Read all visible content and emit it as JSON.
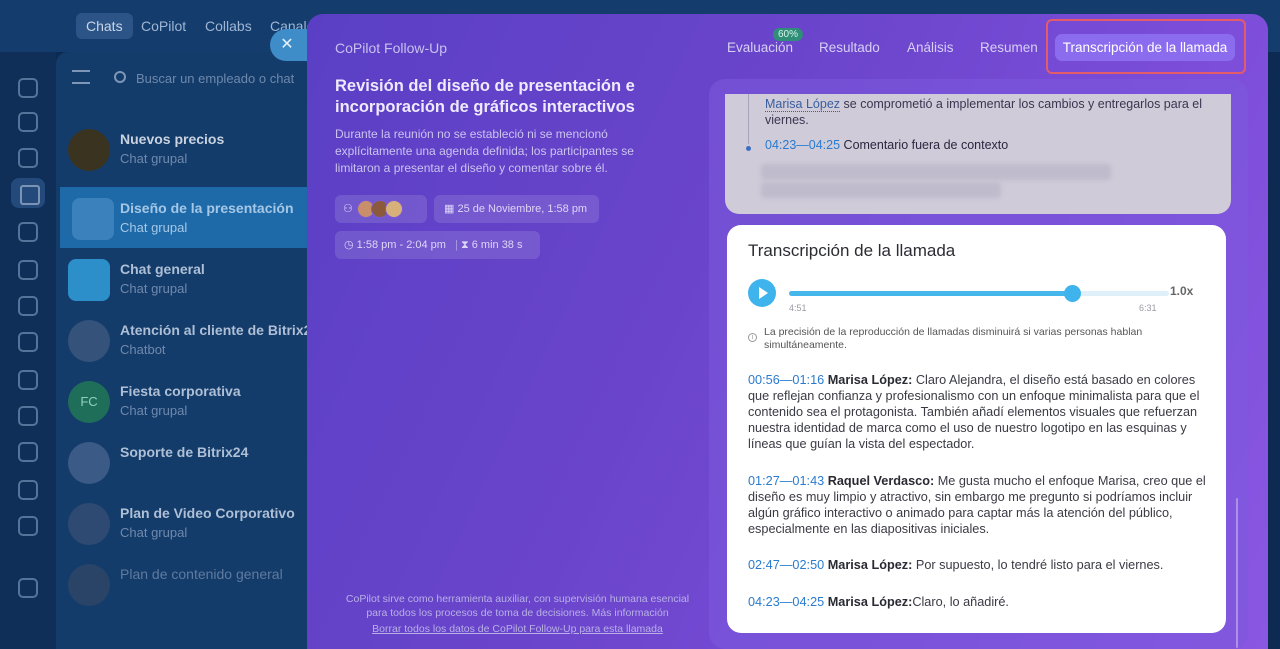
{
  "topnav": {
    "tabs": [
      "Chats",
      "CoPilot",
      "Collabs",
      "Canale"
    ]
  },
  "chatlist": {
    "search_placeholder": "Buscar un empleado o chat",
    "items": [
      {
        "name": "Nuevos precios",
        "sub": "Chat grupal"
      },
      {
        "name": "Diseño de la presentación",
        "sub": "Chat grupal"
      },
      {
        "name": "Chat general",
        "sub": "Chat grupal"
      },
      {
        "name": "Atención al cliente de Bitrix2",
        "sub": "Chatbot"
      },
      {
        "name": "Fiesta corporativa",
        "sub": "Chat grupal",
        "avatar_text": "FC"
      },
      {
        "name": "Soporte de Bitrix24",
        "sub": ""
      },
      {
        "name": "Plan de Video Corporativo",
        "sub": "Chat grupal"
      },
      {
        "name": "Plan de contenido general",
        "sub": ""
      }
    ]
  },
  "panel": {
    "title": "CoPilot Follow-Up",
    "tabs": {
      "evaluacion": "Evaluación",
      "evaluacion_badge": "60%",
      "resultado": "Resultado",
      "analisis": "Análisis",
      "resumen": "Resumen",
      "transcripcion": "Transcripción de la llamada"
    },
    "event_title": "Revisión del diseño de presentación e incorporación de gráficos interactivos",
    "event_desc": "Durante la reunión no se estableció ni se mencionó explícitamente una agenda definida; los participantes se limitaron a presentar el diseño y comentar sobre él.",
    "date": "25 de Noviembre, 1:58 pm",
    "time_range": "1:58 pm - 2:04 pm",
    "duration": "6 min 38 s",
    "footer": "CoPilot sirve como herramienta auxiliar, con supervisión humana esencial para todos los procesos de toma de decisiones. Más información",
    "footer_link": "Borrar todos los datos de CoPilot Follow-Up para esta llamada"
  },
  "prev_card": {
    "name": "Marisa López",
    "line1_rest": " se comprometió a implementar los cambios y entregarlos para el viernes.",
    "ts": "04:23—04:25",
    "line2_rest": " Comentario fuera de contexto"
  },
  "transcript": {
    "title": "Transcripción de la llamada",
    "player": {
      "current": "4:51",
      "total": "6:31",
      "speed": "1.0x",
      "progress": 0.745
    },
    "info": "La precisión de la reproducción de llamadas disminuirá si varias personas hablan simultáneamente.",
    "entries": [
      {
        "ts": "00:56—01:16",
        "speaker": "Marisa López:",
        "text": " Claro Alejandra, el diseño está basado en colores que reflejan confianza y profesionalismo con un enfoque minimalista para que el contenido sea el protagonista. También añadí elementos visuales que refuerzan nuestra identidad de marca como el uso de nuestro logotipo en las esquinas y líneas que guían la vista del espectador."
      },
      {
        "ts": "01:27—01:43",
        "speaker": "Raquel Verdasco:",
        "text": " Me gusta mucho el enfoque Marisa, creo que el diseño es muy limpio y atractivo, sin embargo me pregunto si podríamos incluir algún gráfico interactivo o animado para captar más la atención del público, especialmente en las diapositivas iniciales."
      },
      {
        "ts": "02:47—02:50",
        "speaker": "Marisa López:",
        "text": " Por supuesto, lo tendré listo para el viernes."
      },
      {
        "ts": "04:23—04:25",
        "speaker": "Marisa López:",
        "text": "Claro, lo añadiré."
      }
    ]
  }
}
